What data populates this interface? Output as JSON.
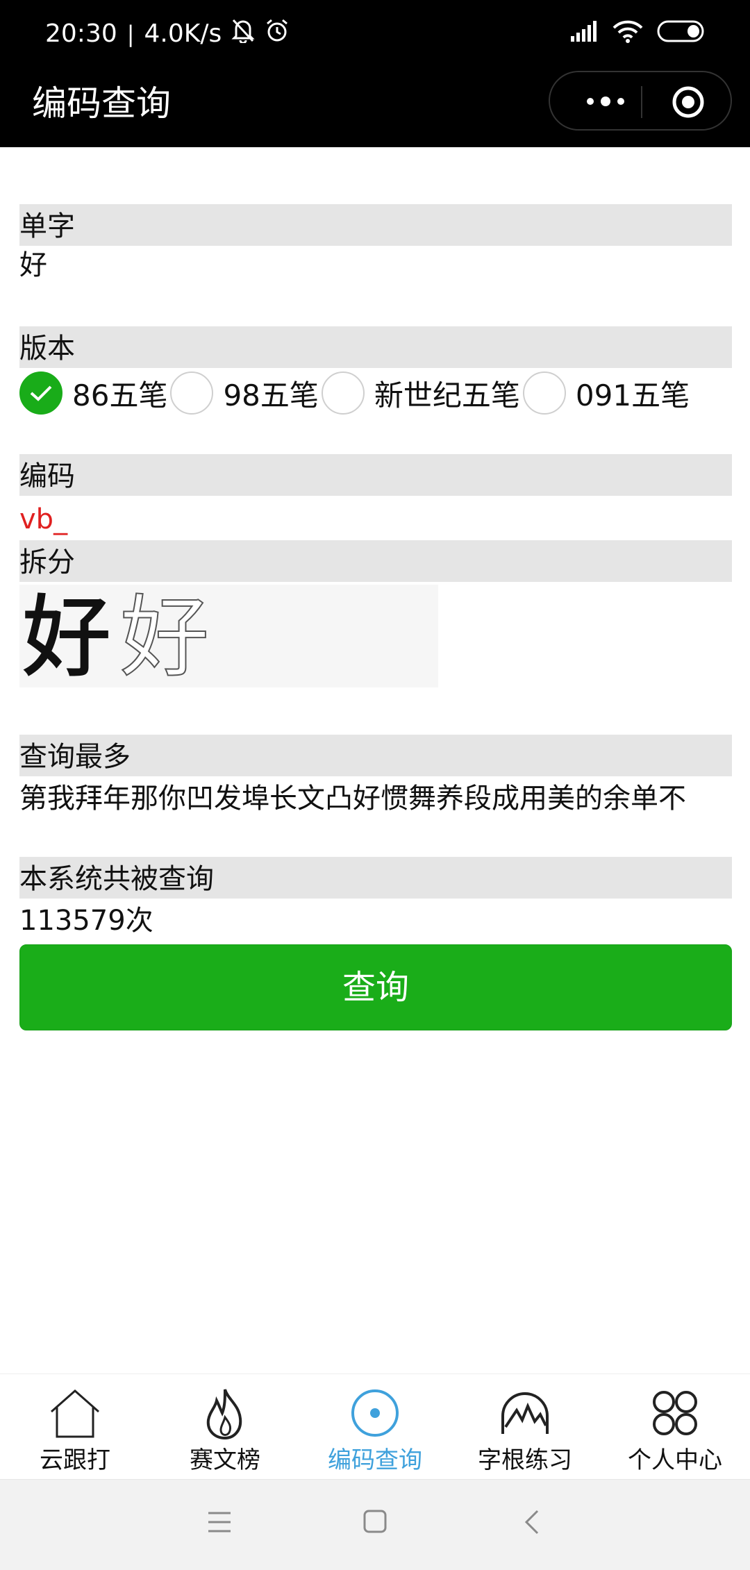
{
  "status": {
    "time": "20:30",
    "speed": "4.0K/s"
  },
  "nav": {
    "title": "编码查询"
  },
  "fields": {
    "char_label": "单字",
    "char_value": "好",
    "version_label": "版本",
    "code_label": "编码",
    "code_value": "vb_",
    "split_label": "拆分",
    "most_label": "查询最多",
    "most_value": "第我拜年那你凹发埠长文凸好惯舞养段成用美的余单不",
    "total_label": "本系统共被查询",
    "total_value": "113579次"
  },
  "versions": [
    {
      "label": "86五笔",
      "checked": true
    },
    {
      "label": "98五笔",
      "checked": false
    },
    {
      "label": "新世纪五笔",
      "checked": false
    },
    {
      "label": "091五笔",
      "checked": false
    }
  ],
  "split_image": {
    "glyphs": "好好"
  },
  "button": {
    "query_label": "查询"
  },
  "tabs": [
    {
      "label": "云跟打",
      "icon": "home-icon",
      "active": false
    },
    {
      "label": "赛文榜",
      "icon": "flame-icon",
      "active": false
    },
    {
      "label": "编码查询",
      "icon": "target-icon",
      "active": true
    },
    {
      "label": "字根练习",
      "icon": "mountain-icon",
      "active": false
    },
    {
      "label": "个人中心",
      "icon": "grid-circles-icon",
      "active": false
    }
  ],
  "colors": {
    "accent_green": "#1aad19",
    "tab_active": "#3fa1dc",
    "code_red": "#e02020"
  }
}
